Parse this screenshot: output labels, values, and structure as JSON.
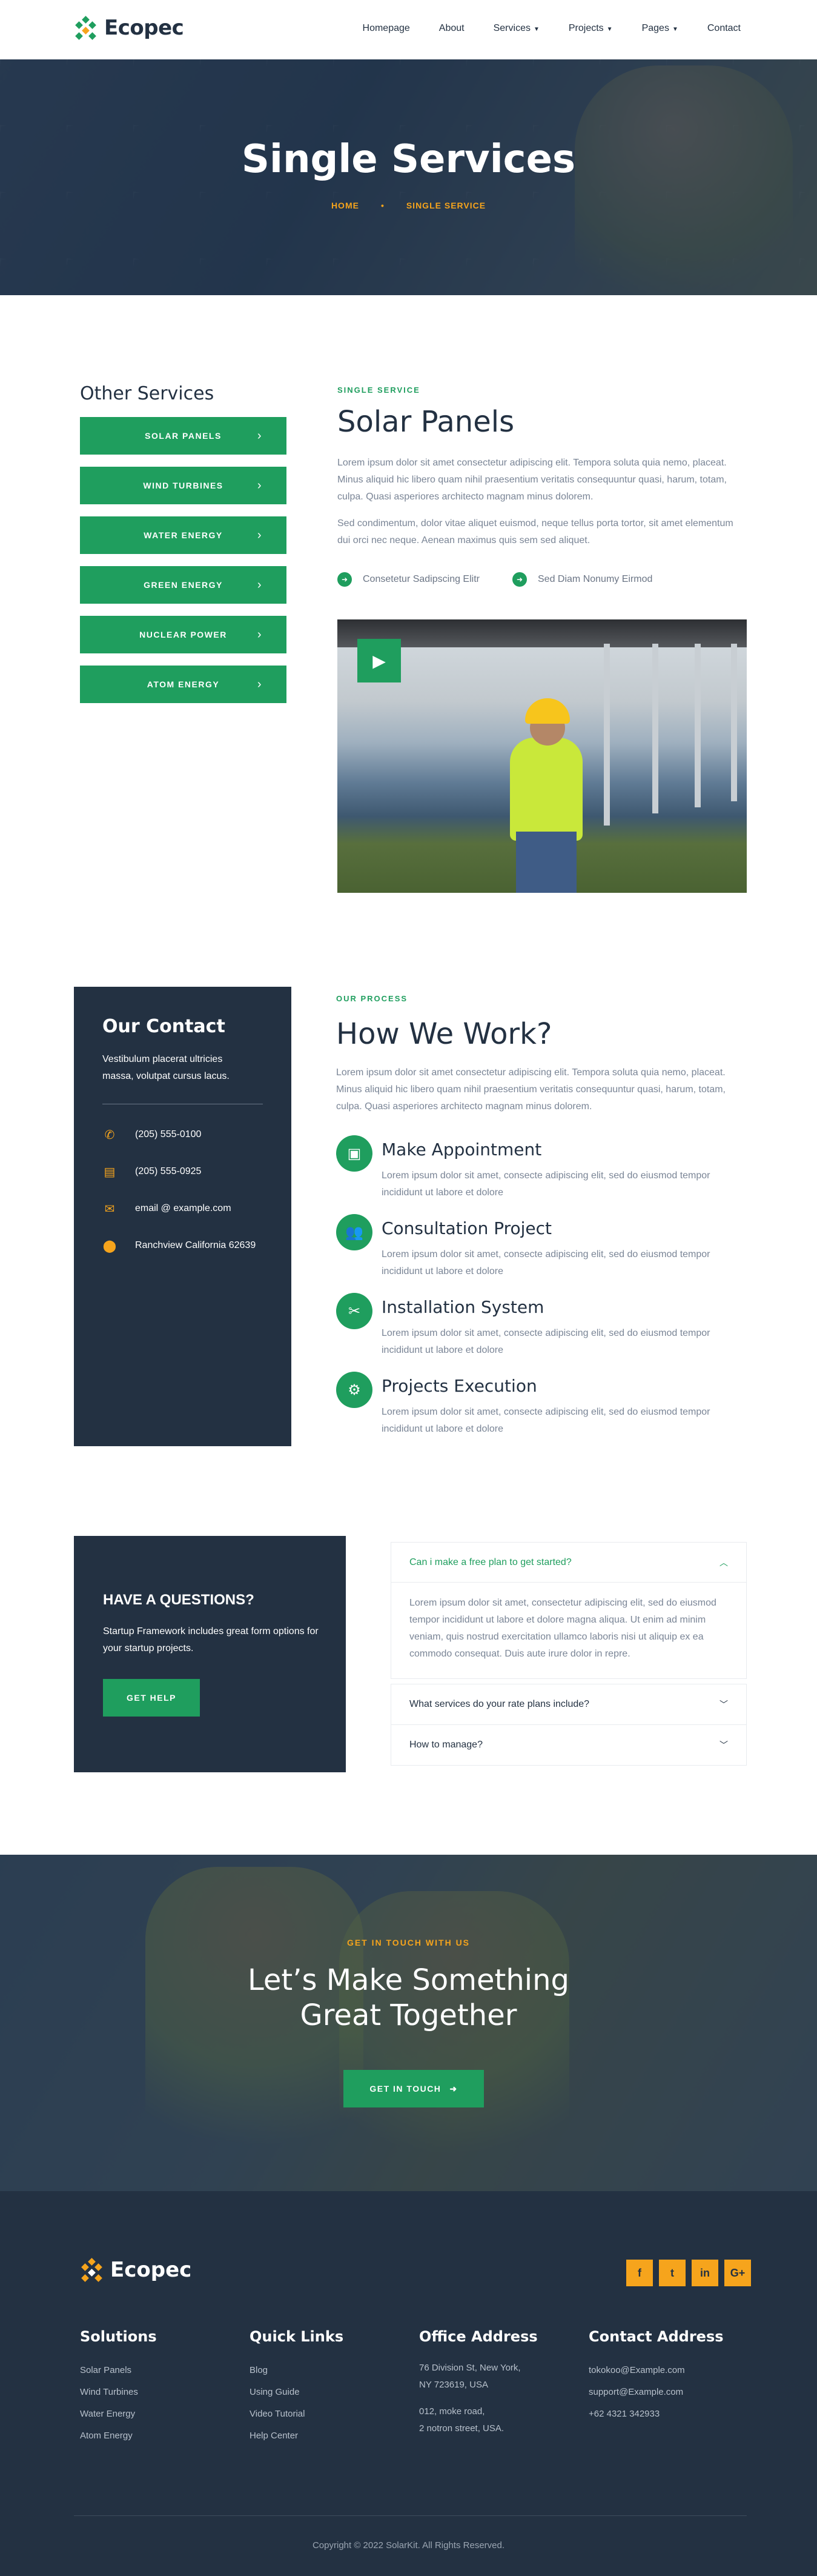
{
  "brand": {
    "name": "Ecopec",
    "accent": "#1f9e5e",
    "secondary": "#f6a41c",
    "dark": "#233142"
  },
  "nav": [
    {
      "label": "Homepage",
      "dropdown": false
    },
    {
      "label": "About",
      "dropdown": false
    },
    {
      "label": "Services",
      "dropdown": true
    },
    {
      "label": "Projects",
      "dropdown": true
    },
    {
      "label": "Pages",
      "dropdown": true
    },
    {
      "label": "Contact",
      "dropdown": false
    }
  ],
  "hero": {
    "title": "Single Services",
    "crumb_home": "HOME",
    "crumb_sep": "•",
    "crumb_current": "SINGLE SERVICE"
  },
  "sidebar": {
    "title": "Other Services",
    "items": [
      "SOLAR PANELS",
      "WIND TURBINES",
      "WATER ENERGY",
      "GREEN ENERGY",
      "NUCLEAR POWER",
      "ATOM ENERGY"
    ]
  },
  "service": {
    "eyebrow": "SINGLE SERVICE",
    "title": "Solar Panels",
    "para1": "Lorem ipsum dolor sit amet consectetur adipiscing elit. Tempora soluta quia nemo, placeat. Minus aliquid hic libero quam nihil praesentium veritatis consequuntur quasi, harum, totam, culpa. Quasi asperiores architecto magnam minus dolorem.",
    "para2": "Sed condimentum, dolor vitae aliquet euismod, neque tellus porta tortor, sit amet elementum dui orci nec neque. Aenean maximus quis sem sed aliquet.",
    "check1": "Consetetur Sadipscing Elitr",
    "check2": "Sed Diam Nonumy Eirmod"
  },
  "contact": {
    "title": "Our Contact",
    "desc": "Vestibulum placerat ultricies massa, volutpat cursus lacus.",
    "phone": "(205) 555-0100",
    "fax": "(205) 555-0925",
    "email": "email @ example.com",
    "address": "Ranchview California 62639"
  },
  "process": {
    "eyebrow": "OUR PROCESS",
    "title": "How We Work?",
    "intro": "Lorem ipsum dolor sit amet consectetur adipiscing elit. Tempora soluta quia nemo, placeat. Minus aliquid hic libero quam nihil praesentium veritatis consequuntur quasi, harum, totam, culpa. Quasi asperiores architecto magnam minus dolorem.",
    "steps": [
      {
        "title": "Make Appointment",
        "desc": "Lorem ipsum dolor sit amet, consecte adipiscing elit, sed do eiusmod tempor incididunt ut labore et dolore",
        "icon": "appointment-icon"
      },
      {
        "title": "Consultation Project",
        "desc": "Lorem ipsum dolor sit amet, consecte adipiscing elit, sed do eiusmod tempor incididunt ut labore et dolore",
        "icon": "people-icon"
      },
      {
        "title": "Installation System",
        "desc": "Lorem ipsum dolor sit amet, consecte adipiscing elit, sed do eiusmod tempor incididunt ut labore et dolore",
        "icon": "tools-icon"
      },
      {
        "title": "Projects Execution",
        "desc": "Lorem ipsum dolor sit amet, consecte adipiscing elit, sed do eiusmod tempor incididunt ut labore et dolore",
        "icon": "execution-icon"
      }
    ]
  },
  "questions": {
    "title": "HAVE A QUESTIONS?",
    "desc": "Startup Framework includes great form options for your startup projects.",
    "button": "GET HELP"
  },
  "faq": [
    {
      "q": "Can i make a free plan to get started?",
      "open": true,
      "a": "Lorem ipsum dolor sit amet, consectetur adipiscing elit, sed do eiusmod tempor incididunt ut labore et dolore magna aliqua. Ut enim ad minim veniam, quis nostrud exercitation ullamco laboris nisi ut aliquip ex ea commodo consequat. Duis aute irure dolor in repre."
    },
    {
      "q": "What services do your rate plans include?",
      "open": false
    },
    {
      "q": "How to manage?",
      "open": false
    }
  ],
  "cta": {
    "eyebrow": "GET IN TOUCH WITH US",
    "title_line1": "Let’s Make Something",
    "title_line2": "Great Together",
    "button": "GET IN TOUCH"
  },
  "footer": {
    "socials": [
      "facebook-icon",
      "twitter-icon",
      "linkedin-icon",
      "google-plus-icon"
    ],
    "solutions": {
      "title": "Solutions",
      "items": [
        "Solar Panels",
        "Wind Turbines",
        "Water Energy",
        "Atom Energy"
      ]
    },
    "quick_links": {
      "title": "Quick Links",
      "items": [
        "Blog",
        "Using Guide",
        "Video Tutorial",
        "Help Center"
      ]
    },
    "office": {
      "title": "Office Address",
      "line1": "76 Division St, New York,",
      "line2": "NY 723619, USA",
      "line3": "012, moke road,",
      "line4": "2 notron street, USA."
    },
    "contact_address": {
      "title": "Contact Address",
      "items": [
        "tokokoo@Example.com",
        "support@Example.com",
        "+62 4321 342933"
      ]
    },
    "copyright": "Copyright © 2022 SolarKit. All Rights Reserved."
  }
}
